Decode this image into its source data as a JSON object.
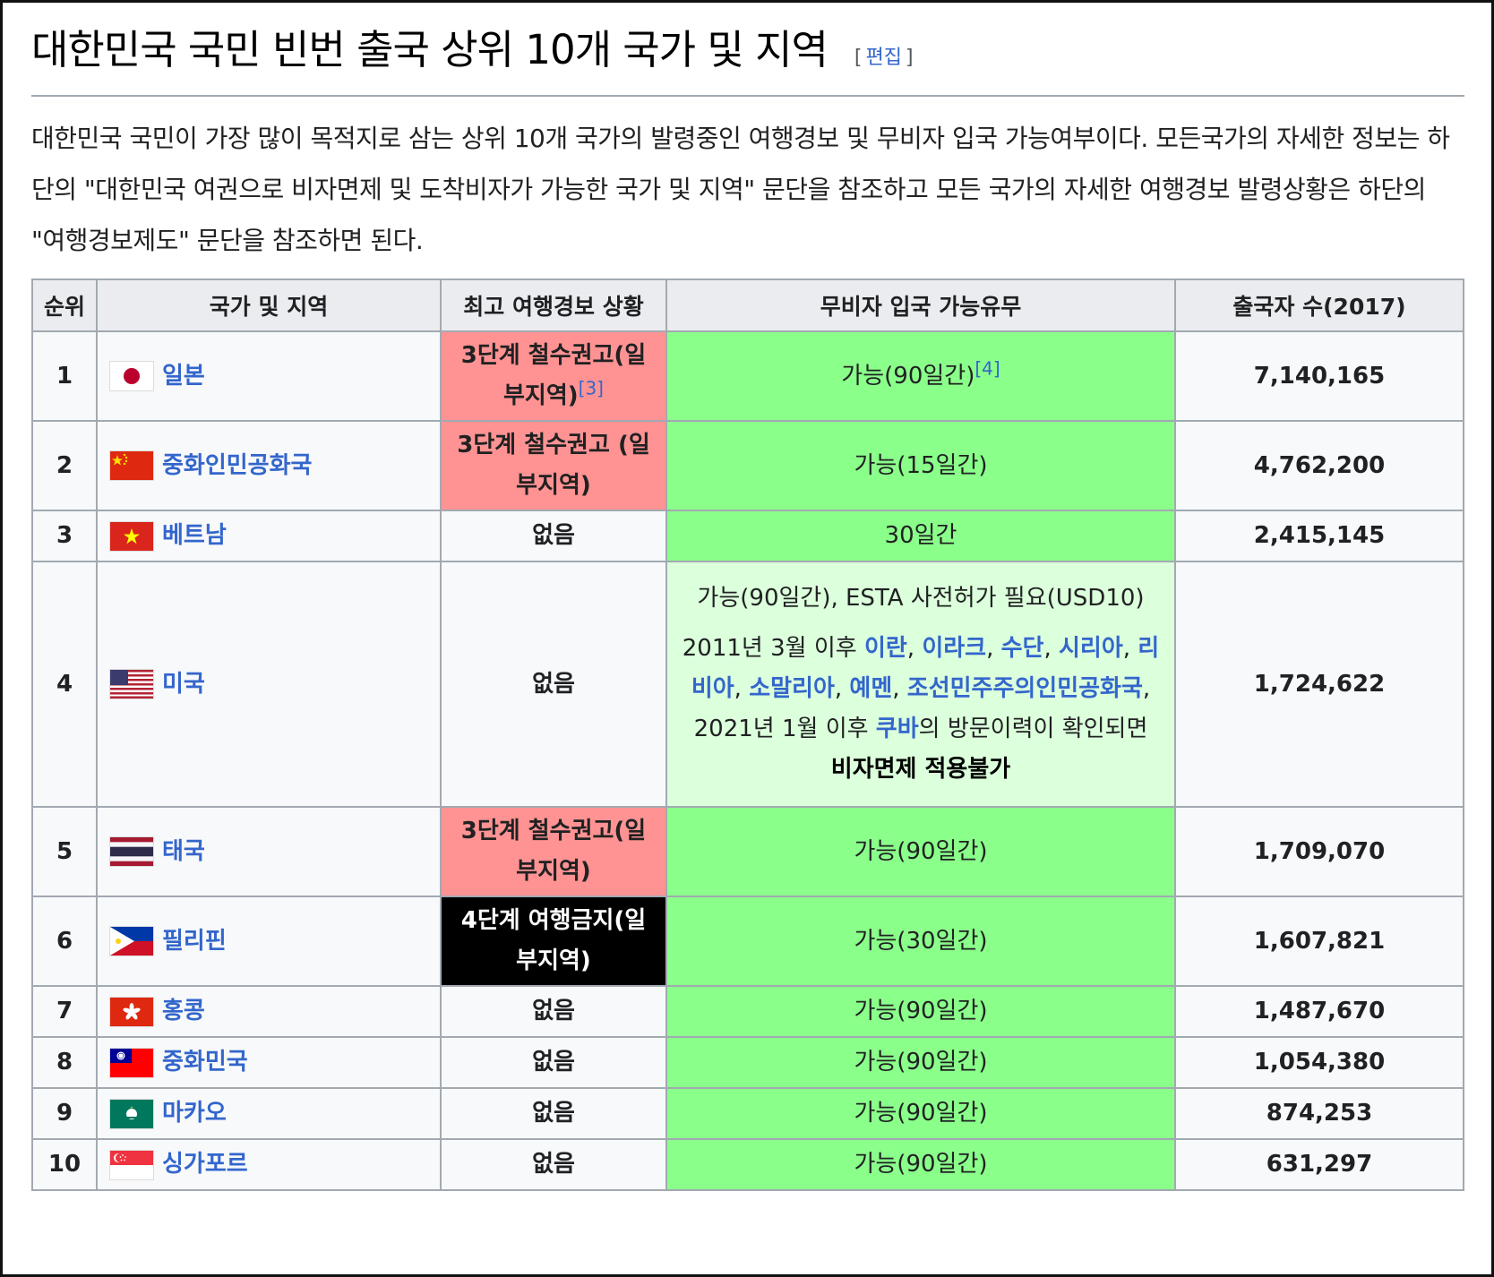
{
  "heading": {
    "title": "대한민국 국민 빈번 출국 상위 10개 국가 및 지역",
    "edit_open": "[",
    "edit_label": "편집",
    "edit_close": "]"
  },
  "intro": "대한민국 국민이 가장 많이 목적지로 삼는 상위 10개 국가의 발령중인 여행경보 및 무비자 입국 가능여부이다. 모든국가의 자세한 정보는 하단의 \"대한민국 여권으로 비자면제 및 도착비자가 가능한 국가 및 지역\" 문단을 참조하고 모든 국가의 자세한 여행경보 발령상황은 하단의 \"여행경보제도\" 문단을 참조하면 된다.",
  "table": {
    "headers": [
      "순위",
      "국가 및 지역",
      "최고 여행경보 상황",
      "무비자 입국 가능유무",
      "출국자 수(2017)"
    ],
    "rows": [
      {
        "rank": "1",
        "country": "일본",
        "flag": "japan-flag-icon",
        "warning": "3단계 철수권고(일부지역)",
        "warning_ref": "[3]",
        "warning_level": "red",
        "visa": "가능(90일간)",
        "visa_ref": "[4]",
        "count": "7,140,165"
      },
      {
        "rank": "2",
        "country": "중화인민공화국",
        "flag": "china-flag-icon",
        "warning": "3단계 철수권고 (일부지역)",
        "warning_level": "red",
        "visa": "가능(15일간)",
        "count": "4,762,200"
      },
      {
        "rank": "3",
        "country": "베트남",
        "flag": "vietnam-flag-icon",
        "warning": "없음",
        "warning_level": "none",
        "visa": "30일간",
        "count": "2,415,145"
      },
      {
        "rank": "4",
        "country": "미국",
        "flag": "usa-flag-icon",
        "warning": "없음",
        "warning_level": "none",
        "visa": "가능(90일간), ESTA 사전허가 필요(USD10)",
        "count": "1,724,622",
        "visa_note": {
          "t1": "2011년 3월 이후 ",
          "l1": "이란",
          "s1": ", ",
          "l2": "이라크",
          "s2": ", ",
          "l3": "수단",
          "s3": ", ",
          "l4": "시리아",
          "s4": ", ",
          "l5": "리비아",
          "s5": ", ",
          "l6": "소말리아",
          "s6": ", ",
          "l7": "예멘",
          "s7": ", ",
          "l8": "조선민주주의인민공화국",
          "t2": ", 2021년 1월 이후 ",
          "l9": "쿠바",
          "t3": "의 방문이력이 확인되면 ",
          "b1": "비자면제 적용불가"
        }
      },
      {
        "rank": "5",
        "country": "태국",
        "flag": "thailand-flag-icon",
        "warning": "3단계 철수권고(일부지역)",
        "warning_level": "red",
        "visa": "가능(90일간)",
        "count": "1,709,070"
      },
      {
        "rank": "6",
        "country": "필리핀",
        "flag": "philippines-flag-icon",
        "warning": "4단계 여행금지(일부지역)",
        "warning_level": "black",
        "visa": "가능(30일간)",
        "count": "1,607,821"
      },
      {
        "rank": "7",
        "country": "홍콩",
        "flag": "hongkong-flag-icon",
        "warning": "없음",
        "warning_level": "none",
        "visa": "가능(90일간)",
        "count": "1,487,670"
      },
      {
        "rank": "8",
        "country": "중화민국",
        "flag": "taiwan-flag-icon",
        "warning": "없음",
        "warning_level": "none",
        "visa": "가능(90일간)",
        "count": "1,054,380"
      },
      {
        "rank": "9",
        "country": "마카오",
        "flag": "macau-flag-icon",
        "warning": "없음",
        "warning_level": "none",
        "visa": "가능(90일간)",
        "count": "874,253"
      },
      {
        "rank": "10",
        "country": "싱가포르",
        "flag": "singapore-flag-icon",
        "warning": "없음",
        "warning_level": "none",
        "visa": "가능(90일간)",
        "count": "631,297"
      }
    ]
  },
  "colors": {
    "warning_red": "#ff9393",
    "warning_black": "#000000",
    "visa_green": "#8aff8a",
    "visa_light_green": "#dcffdc",
    "link": "#3366cc"
  }
}
